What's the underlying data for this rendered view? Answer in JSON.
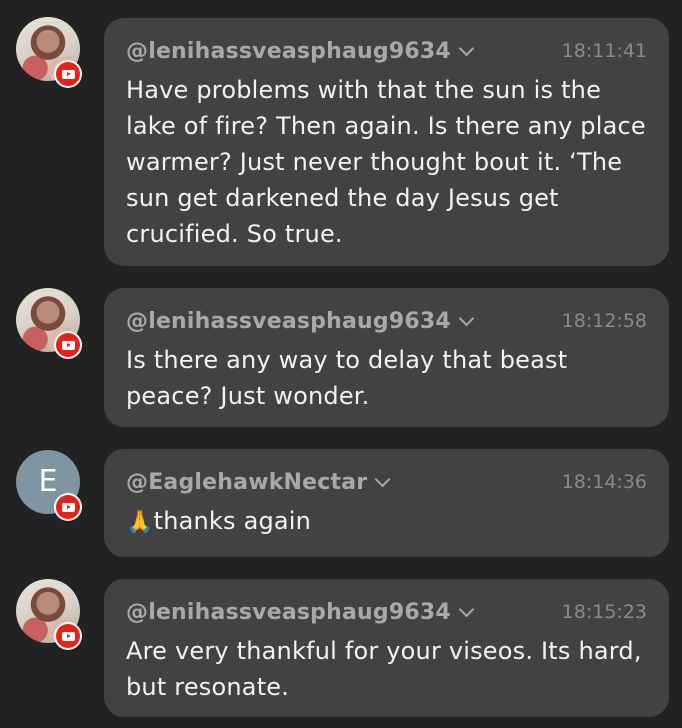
{
  "messages": [
    {
      "author": "@lenihassveasphaug9634",
      "time": "18:11:41",
      "text": "Have problems with that the sun is the lake of fire? Then again. Is there any place warmer? Just never thought bout it. ‘The sun get darkened the day Jesus get crucified. So true.",
      "avatar": "photo",
      "badge_icon": "youtube-icon"
    },
    {
      "author": "@lenihassveasphaug9634",
      "time": "18:12:58",
      "text": "Is there any way to delay that beast peace? Just wonder.",
      "avatar": "photo",
      "badge_icon": "youtube-icon"
    },
    {
      "author": "@EaglehawkNectar",
      "time": "18:14:36",
      "emoji": "🙏",
      "text": "thanks again",
      "avatar_letter": "E",
      "badge_icon": "youtube-icon"
    },
    {
      "author": "@lenihassveasphaug9634",
      "time": "18:15:23",
      "text": "Are very thankful for your viseos. Its hard, but resonate.",
      "avatar": "photo",
      "badge_icon": "youtube-icon"
    }
  ],
  "colors": {
    "background": "#222222",
    "bubble": "#424242",
    "username": "#a9a9a9",
    "timestamp": "#8a8a8a",
    "message_text": "#f2f2f2",
    "youtube_red": "#e62117",
    "letter_avatar": "#7f95a2"
  }
}
